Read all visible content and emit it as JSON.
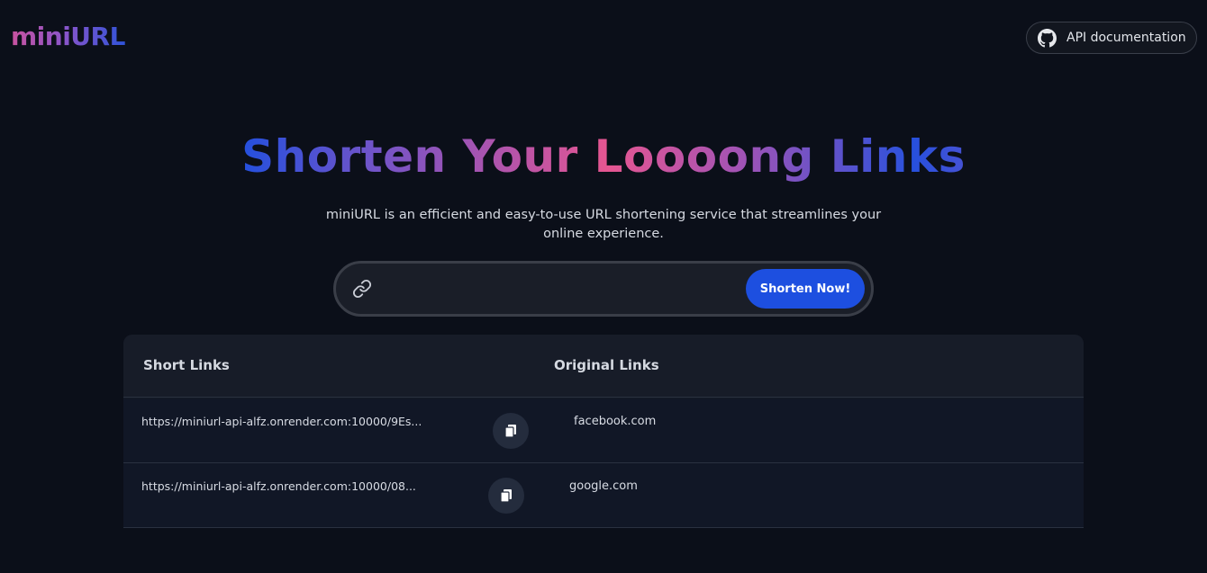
{
  "header": {
    "logo": "miniURL",
    "api_button_label": "API documentation",
    "api_icon": "github-icon"
  },
  "hero": {
    "title": "Shorten Your Loooong Links",
    "subtitle": "miniURL is an efficient and easy-to-use URL shortening service that streamlines your online experience."
  },
  "shortener": {
    "input_value": "",
    "input_icon": "link-icon",
    "button_label": "Shorten Now!"
  },
  "table": {
    "columns": [
      "Short Links",
      "Original Links"
    ],
    "rows": [
      {
        "short": "https://miniurl-api-alfz.onrender.com:10000/9Es...",
        "original": "facebook.com"
      },
      {
        "short": "https://miniurl-api-alfz.onrender.com:10000/08...",
        "original": "google.com"
      }
    ],
    "copy_icon": "copy-icon"
  },
  "colors": {
    "background": "#0b0f19",
    "accent_blue": "#1d4fe0",
    "gradient": [
      "#2450de",
      "#b454aa",
      "#e65691"
    ]
  }
}
